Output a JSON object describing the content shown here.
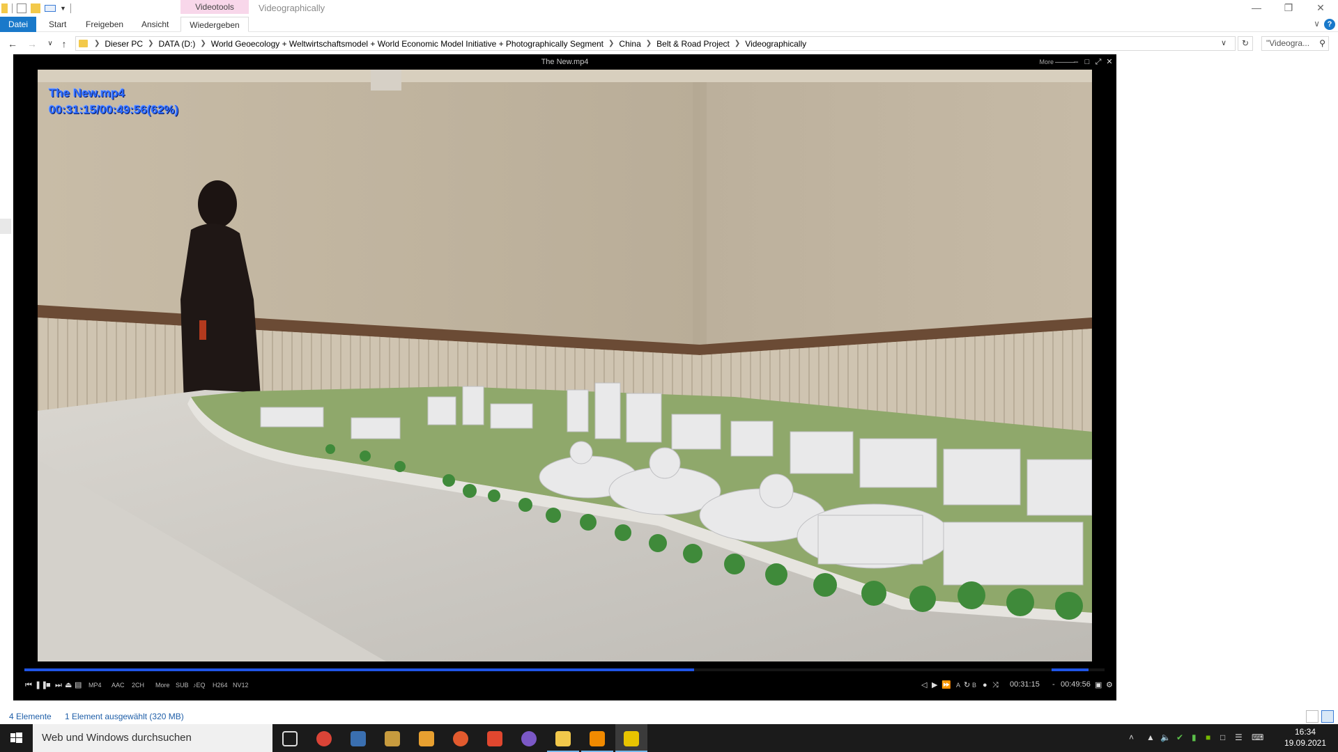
{
  "titlebar": {
    "context_tab": "Videotools",
    "window_title": "Videographically"
  },
  "ribbon": {
    "tabs": [
      "Datei",
      "Start",
      "Freigeben",
      "Ansicht",
      "Wiedergeben"
    ],
    "active_tab": "Wiedergeben"
  },
  "address": {
    "crumbs": [
      "Dieser PC",
      "DATA (D:)",
      "World Geoecology + Weltwirtschaftsmodel + World Economic Model  Initiative + Photographically Segment",
      "China",
      "Belt & Road Project",
      "Videographically"
    ],
    "search_placeholder": "\"Videogra..."
  },
  "player": {
    "title": "The New.mp4",
    "more_label": "More",
    "osd_filename": "The New.mp4",
    "osd_time": "00:31:15/00:49:56(62%)",
    "progress_fraction": 0.62,
    "volume_fraction": 1.0,
    "tags": [
      "MP4",
      "AAC",
      "2CH",
      "More",
      "SUB",
      "♪EQ",
      "H264",
      "NV12"
    ],
    "current_time": "00:31:15",
    "time_separator": "-",
    "total_time": "00:49:56",
    "colors": {
      "accent": "#1f55e6",
      "osd": "#2d6cff"
    }
  },
  "statusbar": {
    "item_count": "4 Elemente",
    "selection": "1 Element ausgewählt (320 MB)"
  },
  "taskbar": {
    "search_placeholder": "Web und Windows durchsuchen",
    "apps": [
      {
        "name": "task-view",
        "color": "#1b1b1b"
      },
      {
        "name": "chrome",
        "color": "#db4437"
      },
      {
        "name": "pdf-viewer",
        "color": "#3a6fb0"
      },
      {
        "name": "image-tool",
        "color": "#c79b3e"
      },
      {
        "name": "media-app",
        "color": "#e8a030"
      },
      {
        "name": "chrome-alt",
        "color": "#e25a2e"
      },
      {
        "name": "swift-app",
        "color": "#e0472f"
      },
      {
        "name": "picasa",
        "color": "#7b58c6"
      },
      {
        "name": "file-explorer",
        "color": "#f2c84b"
      },
      {
        "name": "vlc",
        "color": "#f18a00"
      },
      {
        "name": "video-player",
        "color": "#e8c400"
      }
    ],
    "clock_time": "16:34",
    "clock_date": "19.09.2021"
  }
}
